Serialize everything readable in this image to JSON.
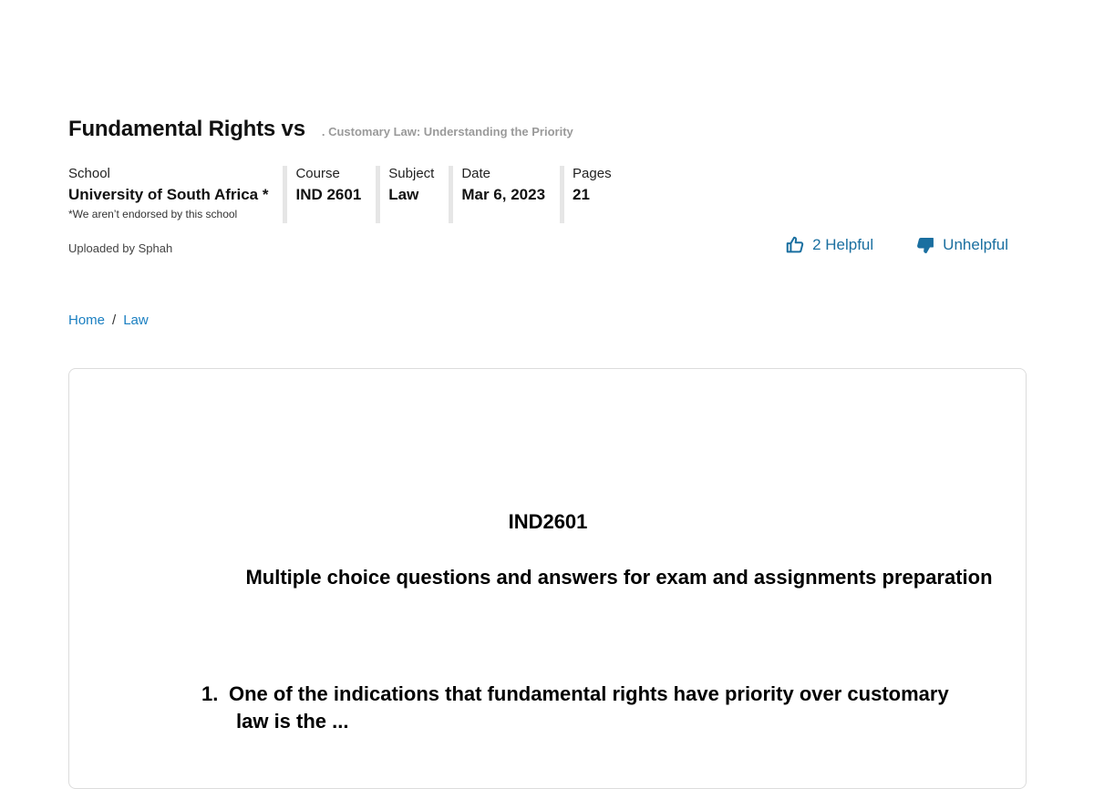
{
  "header": {
    "title": "Fundamental Rights vs",
    "subtitle": ". Customary Law: Understanding the Priority"
  },
  "meta": {
    "school": {
      "label": "School",
      "value": "University of South Africa *",
      "note": "*We aren’t endorsed by this school"
    },
    "course": {
      "label": "Course",
      "value": "IND 2601"
    },
    "subject": {
      "label": "Subject",
      "value": "Law"
    },
    "date": {
      "label": "Date",
      "value": "Mar 6, 2023"
    },
    "pages": {
      "label": "Pages",
      "value": "21"
    }
  },
  "uploaded_by": "Uploaded by Sphah",
  "votes": {
    "helpful_label": "2 Helpful",
    "unhelpful_label": "Unhelpful",
    "helpful_icon": "thumbs-up-icon",
    "unhelpful_icon": "thumbs-down-icon",
    "accent_color": "#1a6fa0"
  },
  "breadcrumb": {
    "items": [
      "Home",
      "Law"
    ],
    "separator": "/"
  },
  "document": {
    "code": "IND2601",
    "heading": "Multiple choice questions and answers for exam and assignments preparation",
    "question_number": "1.",
    "question_line1": "One of the indications that fundamental rights have priority over customary",
    "question_line2": "law is the ..."
  }
}
